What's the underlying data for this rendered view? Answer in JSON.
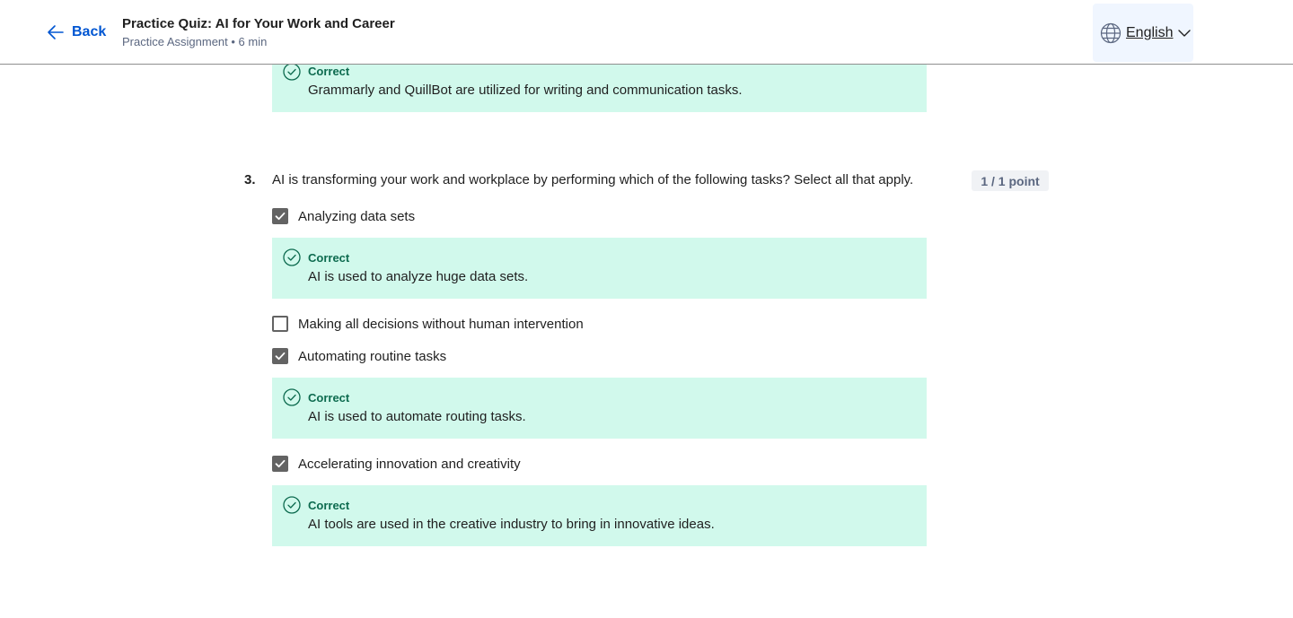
{
  "header": {
    "back_label": "Back",
    "title": "Practice Quiz: AI for Your Work and Career",
    "subtitle": "Practice Assignment • 6 min",
    "language": "English"
  },
  "previous_feedback": {
    "status": "Correct",
    "text": "Grammarly and QuillBot are utilized for writing and communication tasks."
  },
  "question": {
    "number": "3.",
    "text": "AI is transforming your work and workplace by performing which of the following tasks? Select all that apply.",
    "points": "1 / 1 point",
    "options": [
      {
        "label": "Analyzing data sets",
        "checked": true,
        "feedback_status": "Correct",
        "feedback": "AI is used to analyze huge data sets."
      },
      {
        "label": "Making all decisions without human intervention",
        "checked": false
      },
      {
        "label": "Automating routine tasks",
        "checked": true,
        "feedback_status": "Correct",
        "feedback": "AI is used to automate routing tasks."
      },
      {
        "label": "Accelerating innovation and creativity",
        "checked": true,
        "feedback_status": "Correct",
        "feedback": "AI tools are used in the creative industry to bring in innovative ideas."
      }
    ]
  },
  "colors": {
    "accent": "#0056d2",
    "feedback_bg": "#d1f9ec",
    "correct_text": "#0d6b4f",
    "checkbox": "#636363"
  },
  "icons": [
    "arrow-left-icon",
    "globe-icon",
    "chevron-down-icon",
    "check-circle-icon",
    "checkmark-icon"
  ]
}
